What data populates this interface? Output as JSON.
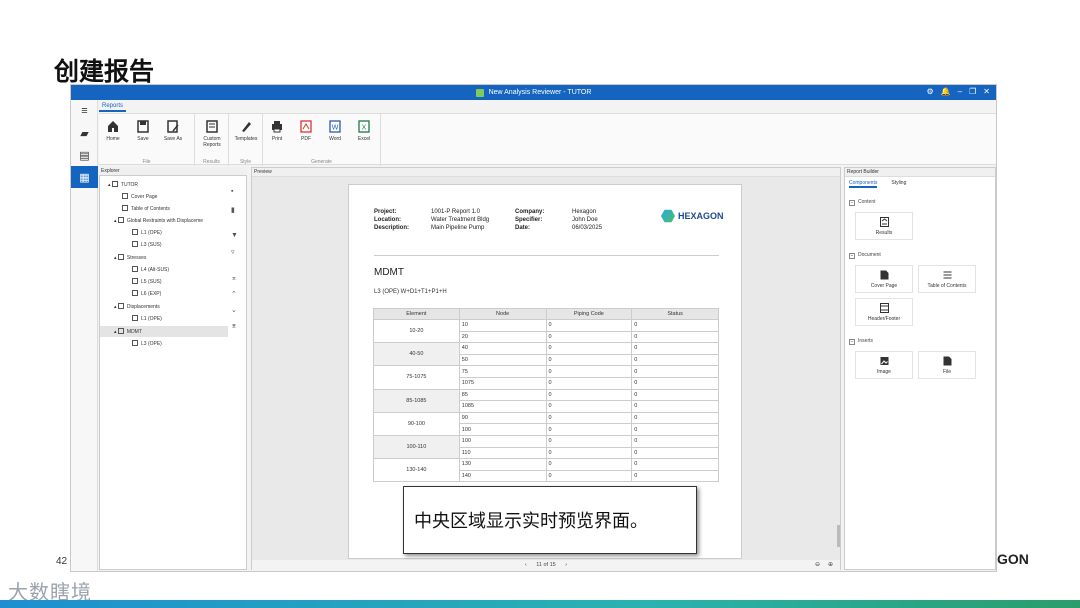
{
  "slide": {
    "title": "创建报告",
    "page_number": "42",
    "brand_fragment": "GON",
    "watermark": "大数瞎境"
  },
  "app": {
    "window_title": "New Analysis Reviewer - TUTOR",
    "ribbon_tab": "Reports",
    "ribbon_groups": {
      "file": {
        "label": "File",
        "buttons": [
          "Home",
          "Save",
          "Save As"
        ]
      },
      "results": {
        "label": "Results",
        "buttons": [
          "Custom Reports"
        ]
      },
      "style": {
        "label": "Style",
        "buttons": [
          "Templates"
        ]
      },
      "generate": {
        "label": "Generate",
        "buttons": [
          "Print",
          "PDF",
          "Word",
          "Excel"
        ]
      }
    },
    "explorer": {
      "title": "Explorer",
      "items": [
        "TUTOR",
        "Cover Page",
        "Table of Contents",
        "Global Restraints with Displaceme",
        "L1 (OPE)",
        "L3 (SUS)",
        "Stresses",
        "L4 (Alt-SUS)",
        "L5 (SUS)",
        "L6 (EXP)",
        "Displacements",
        "L1 (OPE)",
        "MDMT",
        "L3 (OPE)"
      ]
    },
    "preview": {
      "title": "Preview",
      "header": {
        "project_label": "Project:",
        "project": "1001-P Report 1.0",
        "location_label": "Location:",
        "location": "Water Treatment Bldg",
        "description_label": "Description:",
        "description": "Main Pipeline Pump",
        "company_label": "Company:",
        "company": "Hexagon",
        "specifier_label": "Specifier:",
        "specifier": "John Doe",
        "date_label": "Date:",
        "date": "06/03/2025",
        "logo_text": "HEXAGON"
      },
      "section_title": "MDMT",
      "load_case": "L3 (OPE) W+D1+T1+P1+H",
      "table": {
        "headers": [
          "Element",
          "Node",
          "Piping Code",
          "Status"
        ],
        "rows": [
          {
            "element": "10-20",
            "nodes": [
              "10",
              "20"
            ]
          },
          {
            "element": "40-50",
            "nodes": [
              "40",
              "50"
            ]
          },
          {
            "element": "75-1075",
            "nodes": [
              "75",
              "1075"
            ]
          },
          {
            "element": "85-1085",
            "nodes": [
              "85",
              "1085"
            ]
          },
          {
            "element": "90-100",
            "nodes": [
              "90",
              "100"
            ]
          },
          {
            "element": "100-110",
            "nodes": [
              "100",
              "110"
            ]
          },
          {
            "element": "130-140",
            "nodes": [
              "130",
              "140"
            ]
          }
        ],
        "cell_value": "0"
      },
      "pager": "11 of 15"
    },
    "builder": {
      "title": "Report Builder",
      "tabs": [
        "Components",
        "Styling"
      ],
      "sections": {
        "content": {
          "label": "Content",
          "items": [
            "Results"
          ]
        },
        "document": {
          "label": "Document",
          "items": [
            "Cover Page",
            "Table of Contents",
            "Header/Footer"
          ]
        },
        "inserts": {
          "label": "Inserts",
          "items": [
            "Image",
            "File"
          ]
        }
      }
    }
  },
  "callout": "中央区域显示实时预览界面。"
}
